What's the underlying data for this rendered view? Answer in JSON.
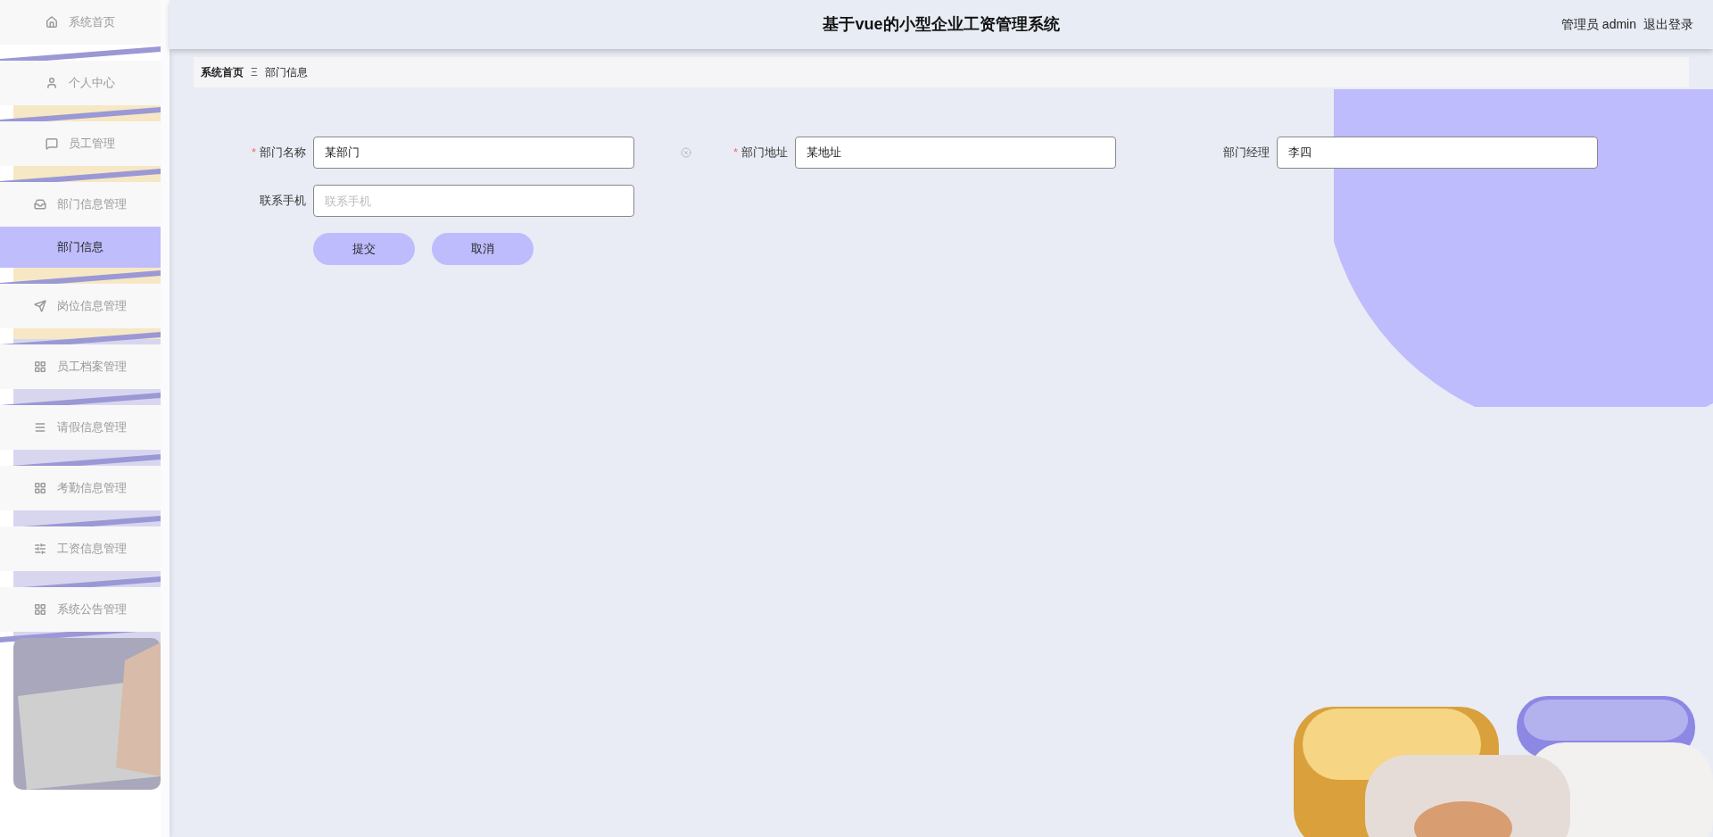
{
  "sidebar": {
    "items": [
      {
        "label": "系统首页",
        "selected": false
      },
      {
        "label": "个人中心",
        "selected": false
      },
      {
        "label": "员工管理",
        "selected": false
      },
      {
        "label": "部门信息管理",
        "selected": false,
        "expanded": true,
        "children": [
          {
            "label": "部门信息",
            "selected": true
          }
        ]
      },
      {
        "label": "岗位信息管理",
        "selected": false
      },
      {
        "label": "员工档案管理",
        "selected": false
      },
      {
        "label": "请假信息管理",
        "selected": false
      },
      {
        "label": "考勤信息管理",
        "selected": false
      },
      {
        "label": "工资信息管理",
        "selected": false
      },
      {
        "label": "系统公告管理",
        "selected": false
      }
    ]
  },
  "header": {
    "title": "基于vue的小型企业工资管理系统",
    "user": "管理员 admin",
    "logout": "退出登录"
  },
  "breadcrumb": {
    "items": [
      "系统首页",
      "部门信息"
    ],
    "separator": "Ξ"
  },
  "form": {
    "fields": [
      {
        "label": "部门名称",
        "required_mark": "*",
        "value": "某部门"
      },
      {
        "label": "部门地址",
        "required_mark": "*",
        "value": "某地址"
      },
      {
        "label": "部门经理",
        "value": "李四"
      },
      {
        "label": "联系手机",
        "placeholder": "联系手机"
      }
    ],
    "buttons": [
      "提交",
      "取消"
    ]
  }
}
